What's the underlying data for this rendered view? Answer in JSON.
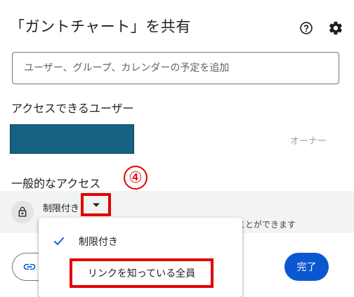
{
  "dialog": {
    "title": "「ガントチャート」を共有",
    "help_icon": "help-circle-icon",
    "settings_icon": "gear-icon"
  },
  "add_people": {
    "placeholder": "ユーザー、グループ、カレンダーの予定を追加"
  },
  "people_section": {
    "label": "アクセスできるユーザー",
    "owner_role": "オーナー"
  },
  "general_access": {
    "label": "一般的なアクセス",
    "current_value": "制限付き",
    "description": "ことができます",
    "step_marker": "④"
  },
  "dropdown_menu": {
    "items": [
      {
        "label": "制限付き",
        "selected": true
      },
      {
        "label": "リンクを知っている全員",
        "selected": false
      }
    ]
  },
  "footer": {
    "done_label": "完了"
  },
  "colors": {
    "primary": "#0b57d0",
    "annotation": "#e00000",
    "redaction": "#176184"
  }
}
